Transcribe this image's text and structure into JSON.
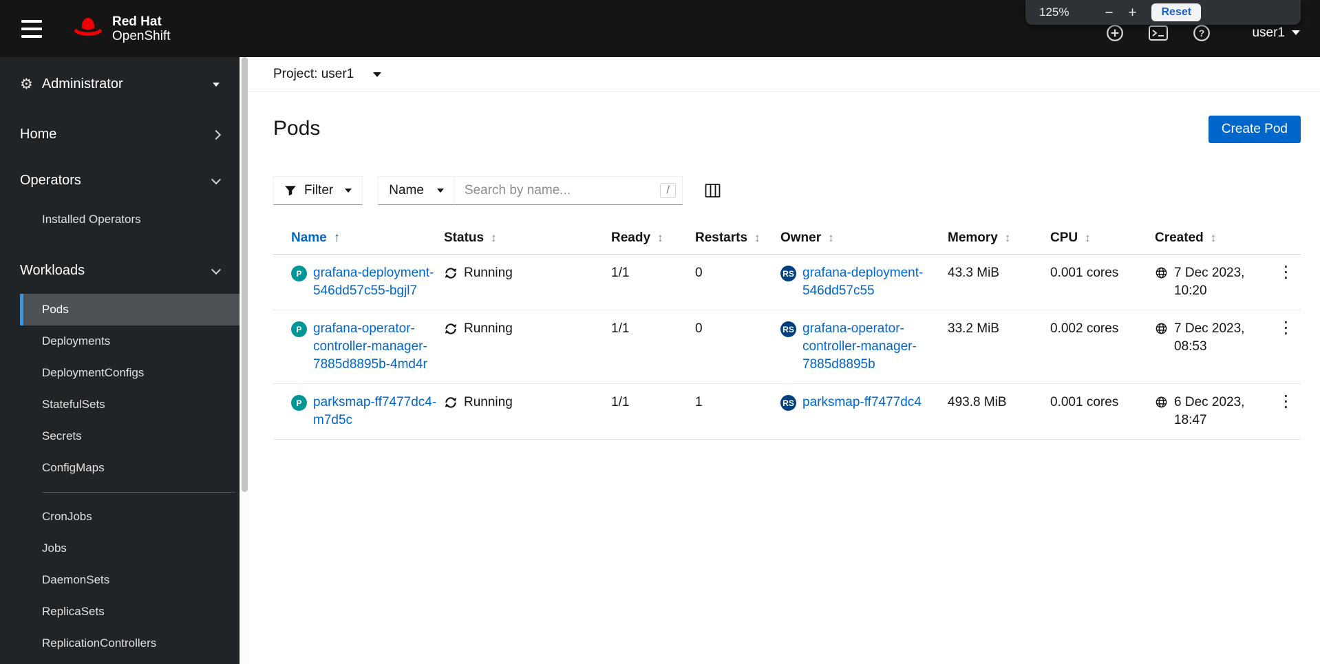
{
  "colors": {
    "accent_blue": "#0066cc",
    "masthead_bg": "#151515",
    "sidebar_bg": "#212427",
    "nav_selected_bg": "#4f5255",
    "nav_selected_border": "#2b9af3",
    "pod_badge_bg": "#009596",
    "replicaset_badge_bg": "#004080",
    "brand_red": "#ee0000"
  },
  "icons": {
    "nav_toggle": "hamburger-icon",
    "brand": "redhat-fedora-icon",
    "quick_create": "plus-circle-icon",
    "web_terminal": "terminal-icon",
    "help": "question-circle-icon",
    "perspective": "gear-icon",
    "filter": "funnel-icon",
    "column_management": "columns-icon",
    "status_running": "sync-icon",
    "created": "globe-icon",
    "row_actions": "kebab-icon",
    "sort_unsorted": "updown-arrow-icon",
    "sort_ascending": "up-arrow-icon"
  },
  "masthead": {
    "brand_line1": "Red Hat",
    "brand_line2": "OpenShift",
    "user_label": "user1"
  },
  "zoom_popup": {
    "level": "125%",
    "minus_label": "−",
    "plus_label": "+",
    "reset_label": "Reset"
  },
  "sidebar": {
    "perspective": "Administrator",
    "home_label": "Home",
    "operators_label": "Operators",
    "operators_items": [
      "Installed Operators"
    ],
    "workloads_label": "Workloads",
    "workloads_items": [
      "Pods",
      "Deployments",
      "DeploymentConfigs",
      "StatefulSets",
      "Secrets",
      "ConfigMaps",
      "CronJobs",
      "Jobs",
      "DaemonSets",
      "ReplicaSets",
      "ReplicationControllers"
    ],
    "selected_item": "Pods"
  },
  "project_bar": {
    "label": "Project:",
    "value": "user1"
  },
  "page": {
    "title": "Pods",
    "create_button_label": "Create Pod"
  },
  "toolbar": {
    "filter_label": "Filter",
    "attribute_selected": "Name",
    "search_placeholder": "Search by name...",
    "shortcut": "/"
  },
  "table": {
    "columns": [
      "Name",
      "Status",
      "Ready",
      "Restarts",
      "Owner",
      "Memory",
      "CPU",
      "Created"
    ],
    "sort": {
      "column": "Name",
      "direction": "ascending"
    },
    "rows": [
      {
        "badge": "P",
        "name": "grafana-deployment-546dd57c55-bgjl7",
        "status": "Running",
        "ready": "1/1",
        "restarts": "0",
        "owner_badge": "RS",
        "owner": "grafana-deployment-546dd57c55",
        "memory": "43.3 MiB",
        "cpu": "0.001 cores",
        "created": "7 Dec 2023, 10:20"
      },
      {
        "badge": "P",
        "name": "grafana-operator-controller-manager-7885d8895b-4md4r",
        "status": "Running",
        "ready": "1/1",
        "restarts": "0",
        "owner_badge": "RS",
        "owner": "grafana-operator-controller-manager-7885d8895b",
        "memory": "33.2 MiB",
        "cpu": "0.002 cores",
        "created": "7 Dec 2023, 08:53"
      },
      {
        "badge": "P",
        "name": "parksmap-ff7477dc4-m7d5c",
        "status": "Running",
        "ready": "1/1",
        "restarts": "1",
        "owner_badge": "RS",
        "owner": "parksmap-ff7477dc4",
        "memory": "493.8 MiB",
        "cpu": "0.001 cores",
        "created": "6 Dec 2023, 18:47"
      }
    ]
  }
}
